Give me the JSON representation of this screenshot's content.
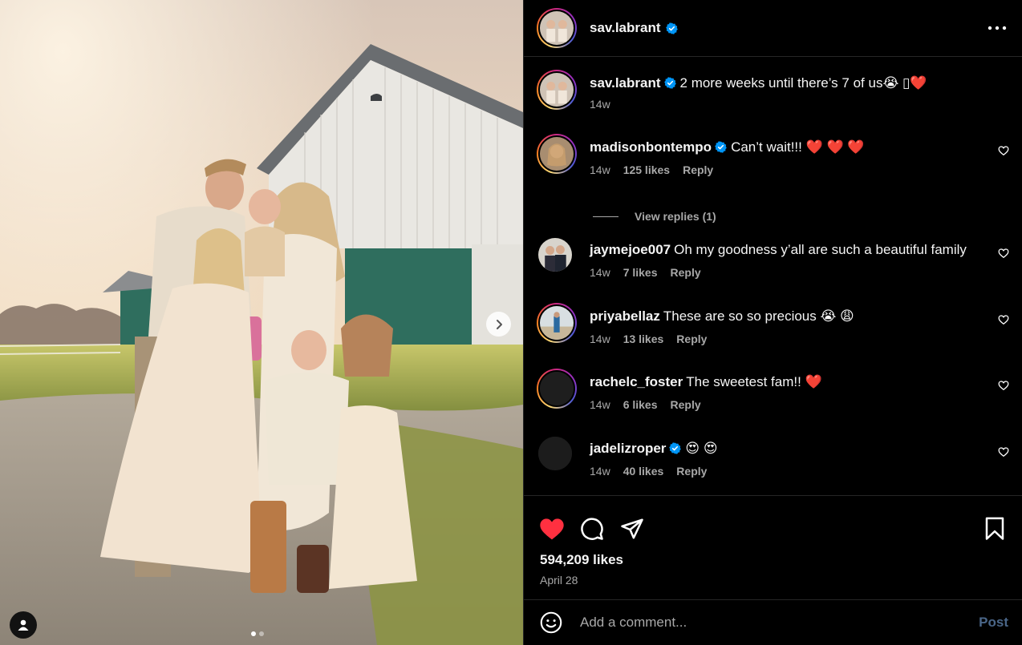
{
  "post": {
    "author": "sav.labrant",
    "likes": "594,209 likes",
    "date": "April 28",
    "caption": {
      "user": "sav.labrant",
      "text": "2 more weeks until there’s 7 of us😭 ▯❤️",
      "time": "14w"
    }
  },
  "comments": [
    {
      "user": "madisonbontempo",
      "verified": true,
      "text": "Can’t wait!!! ❤️ ❤️ ❤️",
      "time": "14w",
      "likes": "125 likes",
      "reply": "Reply",
      "view_replies": "View replies (1)"
    },
    {
      "user": "jaymejoe007",
      "verified": false,
      "text": "Oh my goodness y’all are such a beautiful family",
      "time": "14w",
      "likes": "7 likes",
      "reply": "Reply"
    },
    {
      "user": "priyabellaz",
      "verified": false,
      "text": "These are so so precious 😭 😩",
      "time": "14w",
      "likes": "13 likes",
      "reply": "Reply"
    },
    {
      "user": "rachelc_foster",
      "verified": false,
      "text": "The sweetest fam!! ❤️",
      "time": "14w",
      "likes": "6 likes",
      "reply": "Reply"
    },
    {
      "user": "jadelizroper",
      "verified": true,
      "text": "😍 😍",
      "time": "14w",
      "likes": "40 likes",
      "reply": "Reply"
    }
  ],
  "composer": {
    "placeholder": "Add a comment...",
    "post_label": "Post"
  },
  "carousel": {
    "slide_count": 2,
    "active_slide": 1
  },
  "icons": {
    "verified": "verified-badge-icon",
    "more": "more-options-icon",
    "like": "heart-filled-icon",
    "comment": "comment-bubble-icon",
    "share": "paper-plane-icon",
    "save": "bookmark-icon",
    "emoji": "smiley-icon",
    "tag": "user-tag-icon",
    "next": "chevron-right-icon"
  },
  "colors": {
    "background": "#000000",
    "verified": "#0095f6",
    "like": "#ff3040",
    "muted_text": "#a8a8a8",
    "post_button": "#4a6688"
  }
}
